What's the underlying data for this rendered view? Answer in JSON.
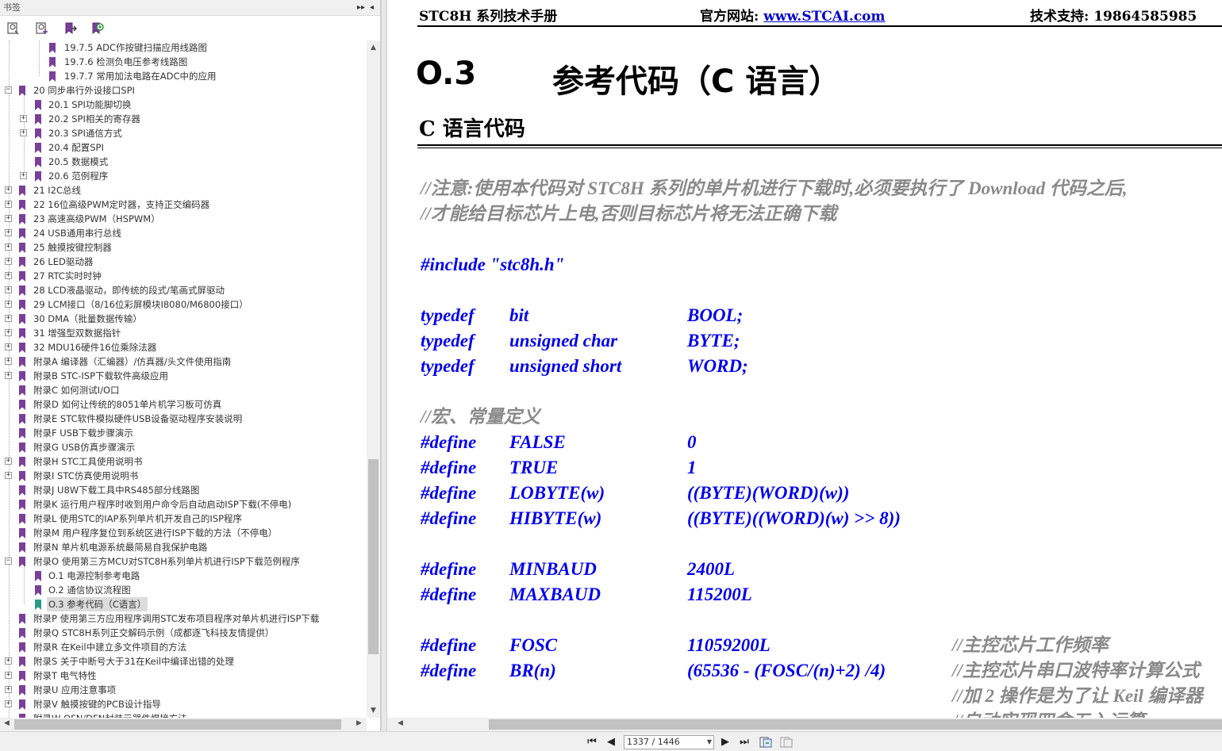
{
  "bookmarks_panel": {
    "title": "书签",
    "toolbar_icons": [
      "bookmark-options-icon",
      "add-bookmark-icon",
      "go-to-bookmark-icon",
      "expand-bookmark-icon"
    ],
    "items": [
      {
        "label": "19.7.5 ADC作按键扫描应用线路图",
        "level": 2,
        "expandable": false,
        "selected": false
      },
      {
        "label": "19.7.6  检测负电压参考线路图",
        "level": 2,
        "expandable": false,
        "selected": false
      },
      {
        "label": "19.7.7  常用加法电路在ADC中的应用",
        "level": 2,
        "expandable": false,
        "selected": false
      },
      {
        "label": "20  同步串行外设接口SPI",
        "level": 0,
        "expandable": true,
        "expanded": true,
        "selected": false
      },
      {
        "label": "20.1 SPI功能脚切换",
        "level": 1,
        "expandable": false,
        "selected": false
      },
      {
        "label": "20.2 SPI相关的寄存器",
        "level": 1,
        "expandable": true,
        "expanded": false,
        "selected": false
      },
      {
        "label": "20.3  SPI通信方式",
        "level": 1,
        "expandable": true,
        "expanded": false,
        "selected": false
      },
      {
        "label": "20.4  配置SPI",
        "level": 1,
        "expandable": false,
        "selected": false
      },
      {
        "label": "20.5  数据模式",
        "level": 1,
        "expandable": false,
        "selected": false
      },
      {
        "label": "20.6  范例程序",
        "level": 1,
        "expandable": true,
        "expanded": false,
        "selected": false
      },
      {
        "label": "21  I2C总线",
        "level": 0,
        "expandable": true,
        "expanded": false,
        "selected": false
      },
      {
        "label": "22  16位高级PWM定时器，支持正交编码器",
        "level": 0,
        "expandable": true,
        "expanded": false,
        "selected": false
      },
      {
        "label": "23  高速高级PWM（HSPWM）",
        "level": 0,
        "expandable": true,
        "expanded": false,
        "selected": false
      },
      {
        "label": "24  USB通用串行总线",
        "level": 0,
        "expandable": true,
        "expanded": false,
        "selected": false
      },
      {
        "label": "25  触摸按键控制器",
        "level": 0,
        "expandable": true,
        "expanded": false,
        "selected": false
      },
      {
        "label": "26  LED驱动器",
        "level": 0,
        "expandable": true,
        "expanded": false,
        "selected": false
      },
      {
        "label": "27  RTC实时时钟",
        "level": 0,
        "expandable": true,
        "expanded": false,
        "selected": false
      },
      {
        "label": "28  LCD液晶驱动，即传统的段式/笔画式屏驱动",
        "level": 0,
        "expandable": true,
        "expanded": false,
        "selected": false
      },
      {
        "label": "29  LCM接口（8/16位彩屏模块I8080/M6800接口）",
        "level": 0,
        "expandable": true,
        "expanded": false,
        "selected": false
      },
      {
        "label": "30  DMA（批量数据传输）",
        "level": 0,
        "expandable": true,
        "expanded": false,
        "selected": false
      },
      {
        "label": "31  增强型双数据指针",
        "level": 0,
        "expandable": true,
        "expanded": false,
        "selected": false
      },
      {
        "label": "32  MDU16硬件16位乘除法器",
        "level": 0,
        "expandable": true,
        "expanded": false,
        "selected": false
      },
      {
        "label": "附录A  编译器（汇编器）/仿真器/头文件使用指南",
        "level": 0,
        "expandable": true,
        "expanded": false,
        "selected": false
      },
      {
        "label": "附录B  STC-ISP下载软件高级应用",
        "level": 0,
        "expandable": true,
        "expanded": false,
        "selected": false
      },
      {
        "label": "附录C  如何测试I/O口",
        "level": 0,
        "expandable": false,
        "selected": false
      },
      {
        "label": "附录D  如何让传统的8051单片机学习板可仿真",
        "level": 0,
        "expandable": false,
        "selected": false
      },
      {
        "label": "附录E  STC软件模拟硬件USB设备驱动程序安装说明",
        "level": 0,
        "expandable": false,
        "selected": false
      },
      {
        "label": "附录F  USB下载步骤演示",
        "level": 0,
        "expandable": false,
        "selected": false
      },
      {
        "label": "附录G  USB仿真步骤演示",
        "level": 0,
        "expandable": false,
        "selected": false
      },
      {
        "label": "附录H  STC工具使用说明书",
        "level": 0,
        "expandable": true,
        "expanded": false,
        "selected": false
      },
      {
        "label": "附录I  STC仿真使用说明书",
        "level": 0,
        "expandable": true,
        "expanded": false,
        "selected": false
      },
      {
        "label": "附录J  U8W下载工具中RS485部分线路图",
        "level": 0,
        "expandable": false,
        "selected": false
      },
      {
        "label": "附录K  运行用户程序时收到用户命令后自动启动ISP下载(不停电)",
        "level": 0,
        "expandable": false,
        "selected": false
      },
      {
        "label": "附录L  使用STC的IAP系列单片机开发自己的ISP程序",
        "level": 0,
        "expandable": false,
        "selected": false
      },
      {
        "label": "附录M  用户程序复位到系统区进行ISP下载的方法（不停电）",
        "level": 0,
        "expandable": false,
        "selected": false
      },
      {
        "label": "附录N  单片机电源系统最简易自我保护电路",
        "level": 0,
        "expandable": false,
        "selected": false
      },
      {
        "label": "附录O  使用第三方MCU对STC8H系列单片机进行ISP下载范例程序",
        "level": 0,
        "expandable": true,
        "expanded": true,
        "selected": false
      },
      {
        "label": "O.1 电源控制参考电路",
        "level": 1,
        "expandable": false,
        "selected": false
      },
      {
        "label": "O.2  通信协议流程图",
        "level": 1,
        "expandable": false,
        "selected": false
      },
      {
        "label": "O.3  参考代码（C语言）",
        "level": 1,
        "expandable": false,
        "selected": true
      },
      {
        "label": "附录P  使用第三方应用程序调用STC发布项目程序对单片机进行ISP下载",
        "level": 0,
        "expandable": false,
        "selected": false
      },
      {
        "label": "附录Q  STC8H系列正交解码示例（成都逐飞科技友情提供）",
        "level": 0,
        "expandable": false,
        "selected": false
      },
      {
        "label": "附录R  在Keil中建立多文件项目的方法",
        "level": 0,
        "expandable": false,
        "selected": false
      },
      {
        "label": "附录S  关于中断号大于31在Keil中编译出错的处理",
        "level": 0,
        "expandable": true,
        "expanded": false,
        "selected": false
      },
      {
        "label": "附录T  电气特性",
        "level": 0,
        "expandable": true,
        "expanded": false,
        "selected": false
      },
      {
        "label": "附录U  应用注意事项",
        "level": 0,
        "expandable": true,
        "expanded": false,
        "selected": false
      },
      {
        "label": "附录V  触摸按键的PCB设计指导",
        "level": 0,
        "expandable": true,
        "expanded": false,
        "selected": false
      },
      {
        "label": "附录W  QFN/DFN封装元器件焊接方法",
        "level": 0,
        "expandable": false,
        "selected": false
      }
    ]
  },
  "document": {
    "header": {
      "left": "STC8H 系列技术手册",
      "site_label": "官方网站: ",
      "site_link": "www.STCAI.com",
      "support": "技术支持: 19864585985"
    },
    "section_number": "O.3",
    "section_title": "参考代码（C 语言）",
    "subtitle": "C 语言代码",
    "code_lines": [
      {
        "style": "gray",
        "cols": [
          "//注意:使用本代码对 STC8H 系列的单片机进行下载时,必须要执行了 Download 代码之后,"
        ]
      },
      {
        "style": "gray",
        "cols": [
          "//才能给目标芯片上电,否则目标芯片将无法正确下载"
        ]
      },
      {
        "style": "blue",
        "cols": [
          "#include \"stc8h.h\""
        ]
      },
      {
        "style": "blue",
        "cols": [
          "typedef",
          "bit",
          "BOOL;"
        ]
      },
      {
        "style": "blue",
        "cols": [
          "typedef",
          "unsigned char",
          "BYTE;"
        ]
      },
      {
        "style": "blue",
        "cols": [
          "typedef",
          "unsigned short",
          "WORD;"
        ]
      },
      {
        "style": "gray",
        "cols": [
          "//宏、常量定义"
        ]
      },
      {
        "style": "blue",
        "cols": [
          "#define",
          "FALSE",
          "0"
        ]
      },
      {
        "style": "blue",
        "cols": [
          "#define",
          "TRUE",
          "1"
        ]
      },
      {
        "style": "blue",
        "cols": [
          "#define",
          "LOBYTE(w)",
          "((BYTE)(WORD)(w))"
        ]
      },
      {
        "style": "blue",
        "cols": [
          "#define",
          "HIBYTE(w)",
          "((BYTE)((WORD)(w) >> 8))"
        ]
      },
      {
        "style": "blue",
        "cols": [
          "#define",
          "MINBAUD",
          "2400L"
        ]
      },
      {
        "style": "blue",
        "cols": [
          "#define",
          "MAXBAUD",
          "115200L"
        ]
      },
      {
        "style": "blue",
        "cols": [
          "#define",
          "FOSC",
          "11059200L"
        ],
        "comment": "//主控芯片工作频率"
      },
      {
        "style": "blue",
        "cols": [
          "#define",
          "BR(n)",
          "(65536 - (FOSC/(n)+2) /4)"
        ],
        "comment": "//主控芯片串口波特率计算公式"
      },
      {
        "style": "gray",
        "cols": [
          "//加 2 操作是为了让 Keil 编译器"
        ]
      },
      {
        "style": "gray",
        "cols": [
          "//自动实现四舍五入运算"
        ]
      }
    ]
  },
  "statusbar": {
    "page_indicator": "1337 / 1446",
    "nav_first": "⏮",
    "nav_prev": "◀",
    "nav_next": "▶",
    "nav_last": "⏭"
  }
}
